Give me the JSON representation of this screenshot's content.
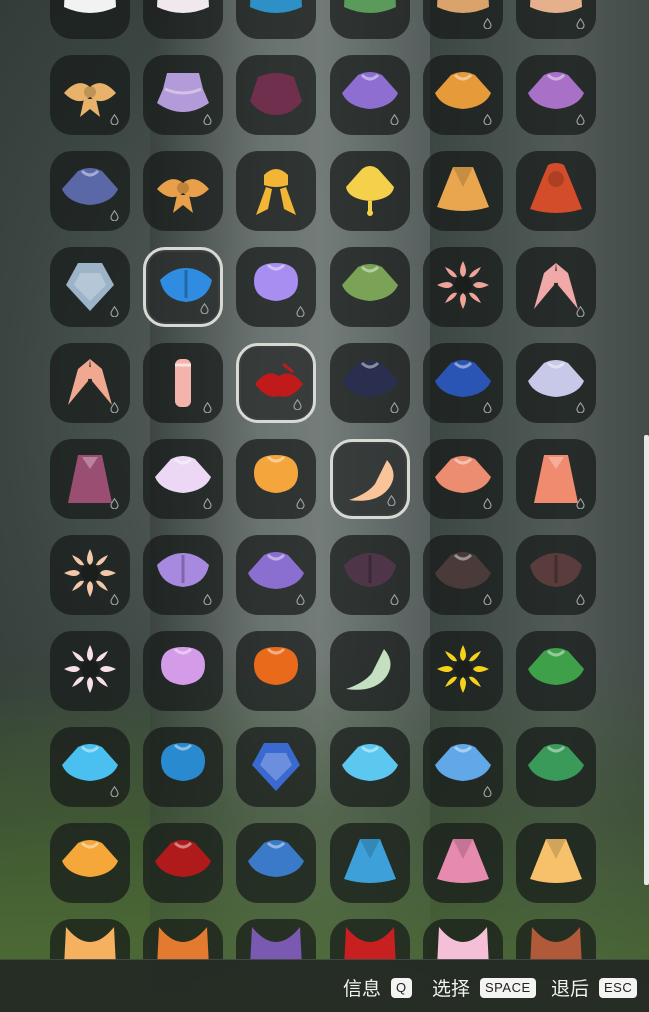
{
  "controls": [
    {
      "label": "信息",
      "key": "Q"
    },
    {
      "label": "选择",
      "key": "SPACE"
    },
    {
      "label": "退后",
      "key": "ESC"
    }
  ],
  "columns": 6,
  "items": [
    {
      "name": "cape-white-puff",
      "color": "#f2f2f2",
      "shape": "top",
      "drop": false
    },
    {
      "name": "cape-white-petal",
      "color": "#f0e8ec",
      "shape": "top",
      "drop": false
    },
    {
      "name": "cape-blue-hood",
      "color": "#2f8fc7",
      "shape": "top",
      "drop": false
    },
    {
      "name": "cape-green-hood",
      "color": "#5a9a5a",
      "shape": "top",
      "drop": false
    },
    {
      "name": "cape-tan-scarf",
      "color": "#d9a36b",
      "shape": "top",
      "drop": true
    },
    {
      "name": "cape-peach-leaf",
      "color": "#e7b08c",
      "shape": "top",
      "drop": true
    },
    {
      "name": "cape-gold-bow",
      "color": "#e9b26a",
      "shape": "bow",
      "drop": true
    },
    {
      "name": "cape-lilac-layered",
      "color": "#b39ad9",
      "shape": "layer",
      "drop": true
    },
    {
      "name": "cape-maroon-fur",
      "color": "#6f2f4d",
      "shape": "fur",
      "drop": false
    },
    {
      "name": "cape-violet-ruffle",
      "color": "#8e6fd1",
      "shape": "wide",
      "drop": true
    },
    {
      "name": "cape-orange-ruffle",
      "color": "#e69a3a",
      "shape": "wide",
      "drop": true
    },
    {
      "name": "cape-purple-umbrella",
      "color": "#a970c8",
      "shape": "wide",
      "drop": true
    },
    {
      "name": "cape-slate-blue",
      "color": "#5a68a8",
      "shape": "wide",
      "drop": true
    },
    {
      "name": "cape-ribbon-sash",
      "color": "#e9a04a",
      "shape": "bow",
      "drop": false
    },
    {
      "name": "cape-gold-knot",
      "color": "#f2b636",
      "shape": "knot",
      "drop": false
    },
    {
      "name": "cape-yellow-bell",
      "color": "#f5d04a",
      "shape": "bell",
      "drop": false
    },
    {
      "name": "cape-orange-poncho",
      "color": "#e9a64f",
      "shape": "poncho",
      "drop": false
    },
    {
      "name": "cape-red-hooded",
      "color": "#d44d2b",
      "shape": "hood",
      "drop": false
    },
    {
      "name": "cape-grey-diamond",
      "color": "#9db4c8",
      "shape": "diamond",
      "drop": true
    },
    {
      "name": "cape-blue-wing",
      "color": "#2f8ce0",
      "shape": "wing",
      "drop": true,
      "selected": true
    },
    {
      "name": "cape-lavender-round",
      "color": "#a78ef0",
      "shape": "round",
      "drop": true
    },
    {
      "name": "cape-moss-green",
      "color": "#7ba356",
      "shape": "wide",
      "drop": false
    },
    {
      "name": "cape-pink-flower",
      "color": "#f0a39a",
      "shape": "flower",
      "drop": false
    },
    {
      "name": "cape-pink-bow",
      "color": "#f0a8a8",
      "shape": "bow2",
      "drop": true
    },
    {
      "name": "cape-peach-leaves",
      "color": "#f0a890",
      "shape": "bow2",
      "drop": true
    },
    {
      "name": "cape-pink-scroll",
      "color": "#f4b4ae",
      "shape": "scroll",
      "drop": true
    },
    {
      "name": "cape-red-lips",
      "color": "#c01a1a",
      "shape": "lips",
      "drop": true,
      "selected": true
    },
    {
      "name": "cape-dark-night",
      "color": "#2a2f4f",
      "shape": "wide",
      "drop": true
    },
    {
      "name": "cape-royal-blue",
      "color": "#2a55b5",
      "shape": "wide",
      "drop": true
    },
    {
      "name": "cape-silver-collar",
      "color": "#c8c8e8",
      "shape": "wide",
      "drop": true
    },
    {
      "name": "cape-mauve-drape",
      "color": "#9a4e72",
      "shape": "drape",
      "drop": true
    },
    {
      "name": "cape-white-violet",
      "color": "#ecd8f4",
      "shape": "wide",
      "drop": true
    },
    {
      "name": "cape-orange-cloud",
      "color": "#f4a63c",
      "shape": "round",
      "drop": true
    },
    {
      "name": "cape-peach-feather",
      "color": "#f9c49a",
      "shape": "feather",
      "drop": true,
      "selected": true
    },
    {
      "name": "cape-salmon-shoulder",
      "color": "#ec8c70",
      "shape": "wide",
      "drop": true
    },
    {
      "name": "cape-coral-collar",
      "color": "#f08b6f",
      "shape": "drape",
      "drop": true
    },
    {
      "name": "cape-lotus-gold",
      "color": "#f2c8a8",
      "shape": "flower",
      "drop": true
    },
    {
      "name": "cape-lavender-wing",
      "color": "#a78ae0",
      "shape": "wing",
      "drop": true
    },
    {
      "name": "cape-violet-scallop",
      "color": "#8b6fd0",
      "shape": "wide",
      "drop": true
    },
    {
      "name": "cape-plum-moth",
      "color": "#4e3648",
      "shape": "wing",
      "drop": true
    },
    {
      "name": "cape-dark-lantern",
      "color": "#4a3a3a",
      "shape": "wide",
      "drop": true
    },
    {
      "name": "cape-bat-lantern",
      "color": "#5a3c3c",
      "shape": "wing",
      "drop": true
    },
    {
      "name": "cape-white-pink-petal",
      "color": "#f8e0ea",
      "shape": "flower",
      "drop": false
    },
    {
      "name": "cape-lilac-bud",
      "color": "#d49ce8",
      "shape": "round",
      "drop": false
    },
    {
      "name": "cape-orange-tulip",
      "color": "#e86a1a",
      "shape": "round",
      "drop": false
    },
    {
      "name": "cape-mint-leaf",
      "color": "#c4e0c0",
      "shape": "feather",
      "drop": false
    },
    {
      "name": "cape-sunflower",
      "color": "#f6d21a",
      "shape": "flower",
      "drop": false
    },
    {
      "name": "cape-green-sprout",
      "color": "#3fa04a",
      "shape": "wide",
      "drop": false
    },
    {
      "name": "cape-sky-cloud",
      "color": "#4ac0f0",
      "shape": "wide",
      "drop": true
    },
    {
      "name": "cape-blue-dotted",
      "color": "#2a8ad0",
      "shape": "round",
      "drop": false
    },
    {
      "name": "cape-cobalt-diamond",
      "color": "#3a6ad0",
      "shape": "diamond",
      "drop": false
    },
    {
      "name": "cape-aqua-rainbow",
      "color": "#5cc8f0",
      "shape": "wide",
      "drop": false
    },
    {
      "name": "cape-blue-rainbow",
      "color": "#60a8e8",
      "shape": "wide",
      "drop": true
    },
    {
      "name": "cape-jade-star",
      "color": "#3a9a5a",
      "shape": "wide",
      "drop": false
    },
    {
      "name": "cape-orange-clover",
      "color": "#f5a73a",
      "shape": "wide",
      "drop": false
    },
    {
      "name": "cape-crimson-star",
      "color": "#b01a1a",
      "shape": "wide",
      "drop": false
    },
    {
      "name": "cape-blue-knit",
      "color": "#3a7ac8",
      "shape": "wide",
      "drop": false
    },
    {
      "name": "cape-striped-blue",
      "color": "#3ea0d8",
      "shape": "poncho",
      "drop": false
    },
    {
      "name": "cape-pink-poncho",
      "color": "#e78ab0",
      "shape": "poncho",
      "drop": false
    },
    {
      "name": "cape-sunset-poncho",
      "color": "#f7c06a",
      "shape": "poncho",
      "drop": false
    },
    {
      "name": "cape-row11-1",
      "color": "#f5b060",
      "shape": "top",
      "drop": false
    },
    {
      "name": "cape-row11-2",
      "color": "#e47a30",
      "shape": "top",
      "drop": false
    },
    {
      "name": "cape-row11-3",
      "color": "#7a5ab0",
      "shape": "top",
      "drop": false
    },
    {
      "name": "cape-row11-4",
      "color": "#c82020",
      "shape": "top",
      "drop": false
    },
    {
      "name": "cape-row11-5",
      "color": "#f4c0d8",
      "shape": "top",
      "drop": false
    },
    {
      "name": "cape-row11-6",
      "color": "#b05a3a",
      "shape": "top",
      "drop": false
    }
  ]
}
